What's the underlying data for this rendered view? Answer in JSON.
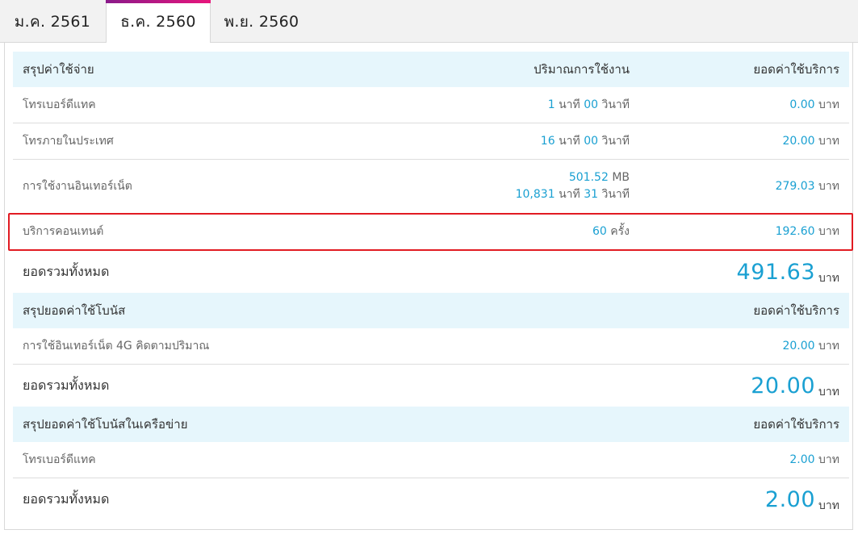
{
  "tabs": [
    "ม.ค. 2561",
    "ธ.ค. 2560",
    "พ.ย. 2560"
  ],
  "section1": {
    "title": "สรุปค่าใช้จ่าย",
    "col_usage": "ปริมาณการใช้งาน",
    "col_amount": "ยอดค่าใช้บริการ",
    "rows": [
      {
        "label": "โทรเบอร์ดีแทค",
        "usage1": {
          "a": "1",
          "b": "นาที",
          "c": "00",
          "d": "วินาที"
        },
        "amount": "0.00",
        "unit": "บาท"
      },
      {
        "label": "โทรภายในประเทศ",
        "usage1": {
          "a": "16",
          "b": "นาที",
          "c": "00",
          "d": "วินาที"
        },
        "amount": "20.00",
        "unit": "บาท"
      },
      {
        "label": "การใช้งานอินเทอร์เน็ต",
        "usage_mb": {
          "a": "501.52",
          "b": "MB"
        },
        "usage2": {
          "a": "10,831",
          "b": "นาที",
          "c": "31",
          "d": "วินาที"
        },
        "amount": "279.03",
        "unit": "บาท"
      },
      {
        "label": "บริการคอนเทนต์",
        "usage_count": {
          "a": "60",
          "b": "ครั้ง"
        },
        "amount": "192.60",
        "unit": "บาท"
      }
    ],
    "total_label": "ยอดรวมทั้งหมด",
    "total_value": "491.63",
    "total_unit": "บาท"
  },
  "section2": {
    "title": "สรุปยอดค่าใช้โบนัส",
    "col_amount": "ยอดค่าใช้บริการ",
    "row": {
      "label": "การใช้อินเทอร์เน็ต 4G คิดตามปริมาณ",
      "amount": "20.00",
      "unit": "บาท"
    },
    "total_label": "ยอดรวมทั้งหมด",
    "total_value": "20.00",
    "total_unit": "บาท"
  },
  "section3": {
    "title": "สรุปยอดค่าใช้โบนัสในเครือข่าย",
    "col_amount": "ยอดค่าใช้บริการ",
    "row": {
      "label": "โทรเบอร์ดีแทค",
      "amount": "2.00",
      "unit": "บาท"
    },
    "total_label": "ยอดรวมทั้งหมด",
    "total_value": "2.00",
    "total_unit": "บาท"
  },
  "colors": {
    "accent": "#1aa0d2",
    "header_bg": "#e6f6fc",
    "highlight": "#e11b22",
    "tab_gradient_start": "#8a1a8a",
    "tab_gradient_end": "#e8157c"
  }
}
